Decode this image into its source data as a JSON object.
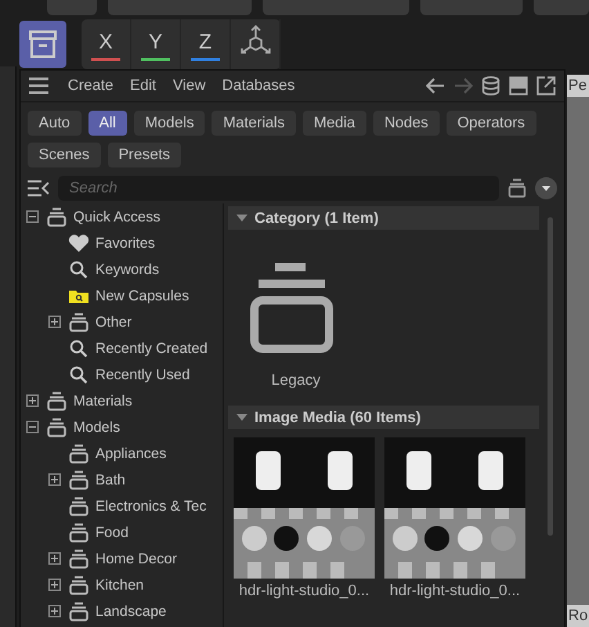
{
  "menu": [
    "Create",
    "Edit",
    "View",
    "Databases"
  ],
  "filters": [
    {
      "label": "Auto",
      "selected": false
    },
    {
      "label": "All",
      "selected": true
    },
    {
      "label": "Models",
      "selected": false
    },
    {
      "label": "Materials",
      "selected": false
    },
    {
      "label": "Media",
      "selected": false
    },
    {
      "label": "Nodes",
      "selected": false
    },
    {
      "label": "Operators",
      "selected": false
    },
    {
      "label": "Scenes",
      "selected": false
    },
    {
      "label": "Presets",
      "selected": false
    }
  ],
  "axes": [
    {
      "label": "X",
      "color": "#d05050"
    },
    {
      "label": "Y",
      "color": "#50c060"
    },
    {
      "label": "Z",
      "color": "#3080e0"
    }
  ],
  "search": {
    "placeholder": "Search"
  },
  "tree": [
    {
      "label": "Quick Access",
      "kind": "category",
      "expanded": true,
      "children": [
        {
          "label": "Favorites",
          "kind": "heart"
        },
        {
          "label": "Keywords",
          "kind": "search"
        },
        {
          "label": "New Capsules",
          "kind": "folder"
        },
        {
          "label": "Other",
          "kind": "category",
          "expanded": false
        },
        {
          "label": "Recently Created",
          "kind": "search"
        },
        {
          "label": "Recently Used",
          "kind": "search"
        }
      ]
    },
    {
      "label": "Materials",
      "kind": "category",
      "expanded": false
    },
    {
      "label": "Models",
      "kind": "category",
      "expanded": true,
      "children": [
        {
          "label": "Appliances",
          "kind": "category"
        },
        {
          "label": "Bath",
          "kind": "category",
          "expanded": false
        },
        {
          "label": "Electronics & Tec",
          "kind": "category"
        },
        {
          "label": "Food",
          "kind": "category"
        },
        {
          "label": "Home Decor",
          "kind": "category",
          "expanded": false
        },
        {
          "label": "Kitchen",
          "kind": "category",
          "expanded": false
        },
        {
          "label": "Landscape",
          "kind": "category",
          "expanded": false
        }
      ]
    }
  ],
  "sections": [
    {
      "title": "Category (1 Item)",
      "items": [
        {
          "label": "Legacy",
          "kind": "category"
        }
      ]
    },
    {
      "title": "Image Media (60 Items)",
      "items": [
        {
          "label": "hdr-light-studio_0...",
          "kind": "image"
        },
        {
          "label": "hdr-light-studio_0...",
          "kind": "image"
        }
      ]
    }
  ],
  "side_panel": {
    "top": "Pe",
    "bottom": "Ro"
  }
}
